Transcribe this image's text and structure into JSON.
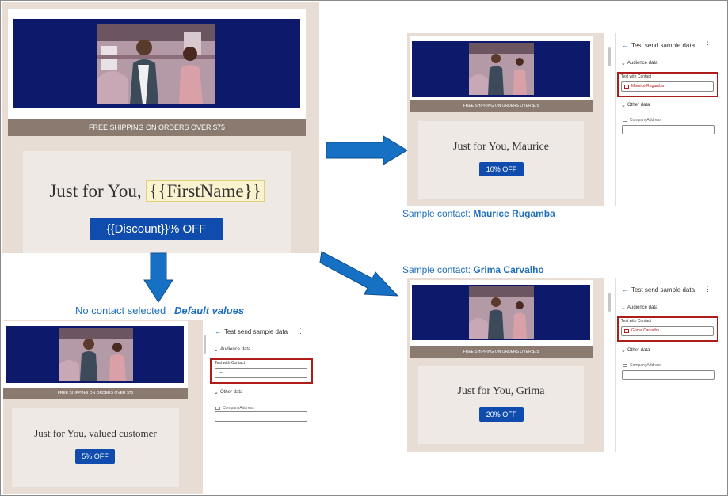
{
  "email": {
    "shipping_banner": "FREE SHIPPING ON ORDERS OVER $75",
    "main_headline_prefix": "Just for You, ",
    "main_headline_token": "{{FirstName}}",
    "main_offer": "{{Discount}}% OFF"
  },
  "panel": {
    "title": "Test send sample data",
    "audience_section": "Audience data",
    "test_with_contact_label": "Test with Contact",
    "other_section": "Other data",
    "company_address_label": "CompanyAddress"
  },
  "previews": {
    "maurice": {
      "headline": "Just for You, Maurice",
      "offer": "10% OFF",
      "contact_value": "Maurice Rugamba",
      "caption_prefix": "Sample contact: ",
      "caption_name": "Maurice Rugamba"
    },
    "grima": {
      "headline": "Just for You, Grima",
      "offer": "20% OFF",
      "contact_value": "Grima Carvalho",
      "caption_prefix": "Sample contact: ",
      "caption_name": "Grima Carvalho"
    },
    "default": {
      "headline": "Just for You, valued customer",
      "offer": "5% OFF",
      "contact_value": "---",
      "caption_prefix": "No contact selected : ",
      "caption_name": "Default values"
    }
  },
  "colors": {
    "arrow": "#1670c4",
    "hero": "#0d1a6b",
    "offer": "#0f4cad",
    "highlight": "#b01c1c"
  }
}
